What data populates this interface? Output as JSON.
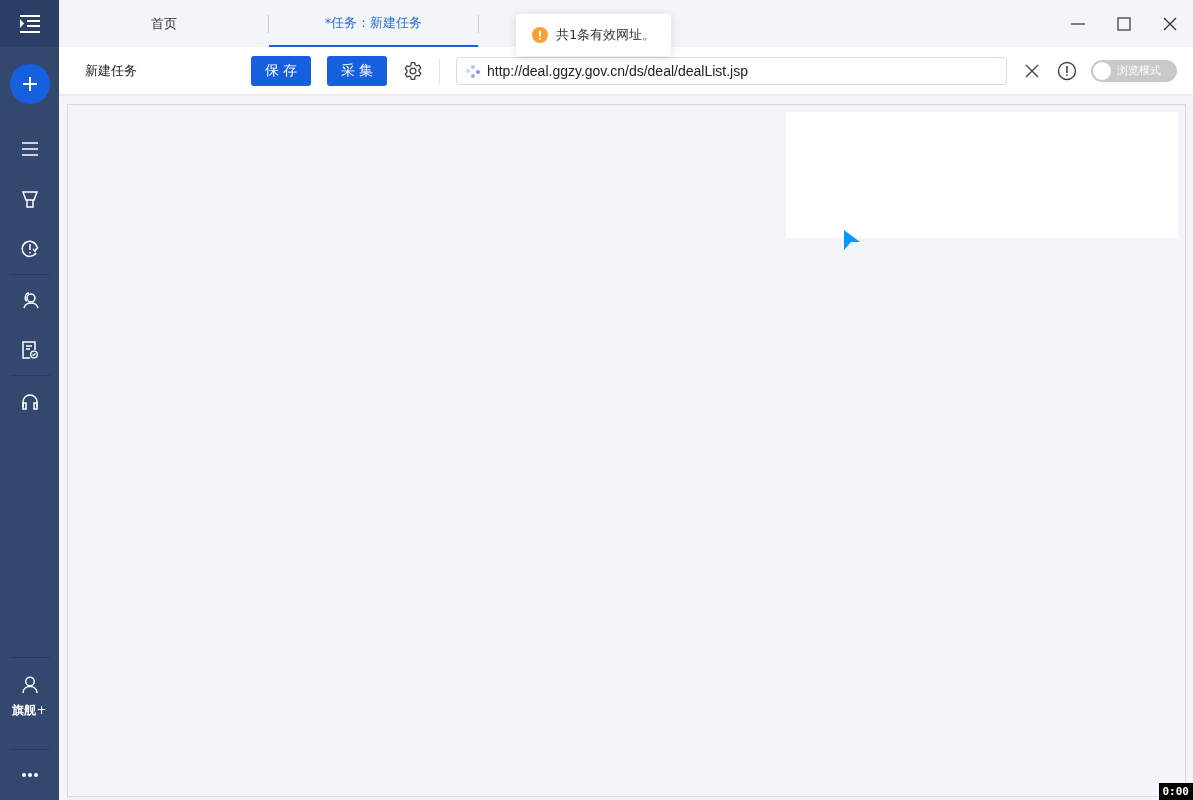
{
  "sidebar": {
    "account_label": "旗舰",
    "account_badge": "+"
  },
  "tabs": [
    {
      "label": "首页",
      "selected": false
    },
    {
      "label": "*任务：新建任务",
      "selected": true
    }
  ],
  "toast": {
    "kind": "warning",
    "message": "共1条有效网址。"
  },
  "toolbar": {
    "title": "新建任务",
    "buttons": [
      "保 存",
      "采 集"
    ],
    "url": "http://deal.ggzy.gov.cn/ds/deal/dealList.jsp",
    "mode_toggle": {
      "label": "浏览模式",
      "on": false
    }
  },
  "timer": "0:00"
}
